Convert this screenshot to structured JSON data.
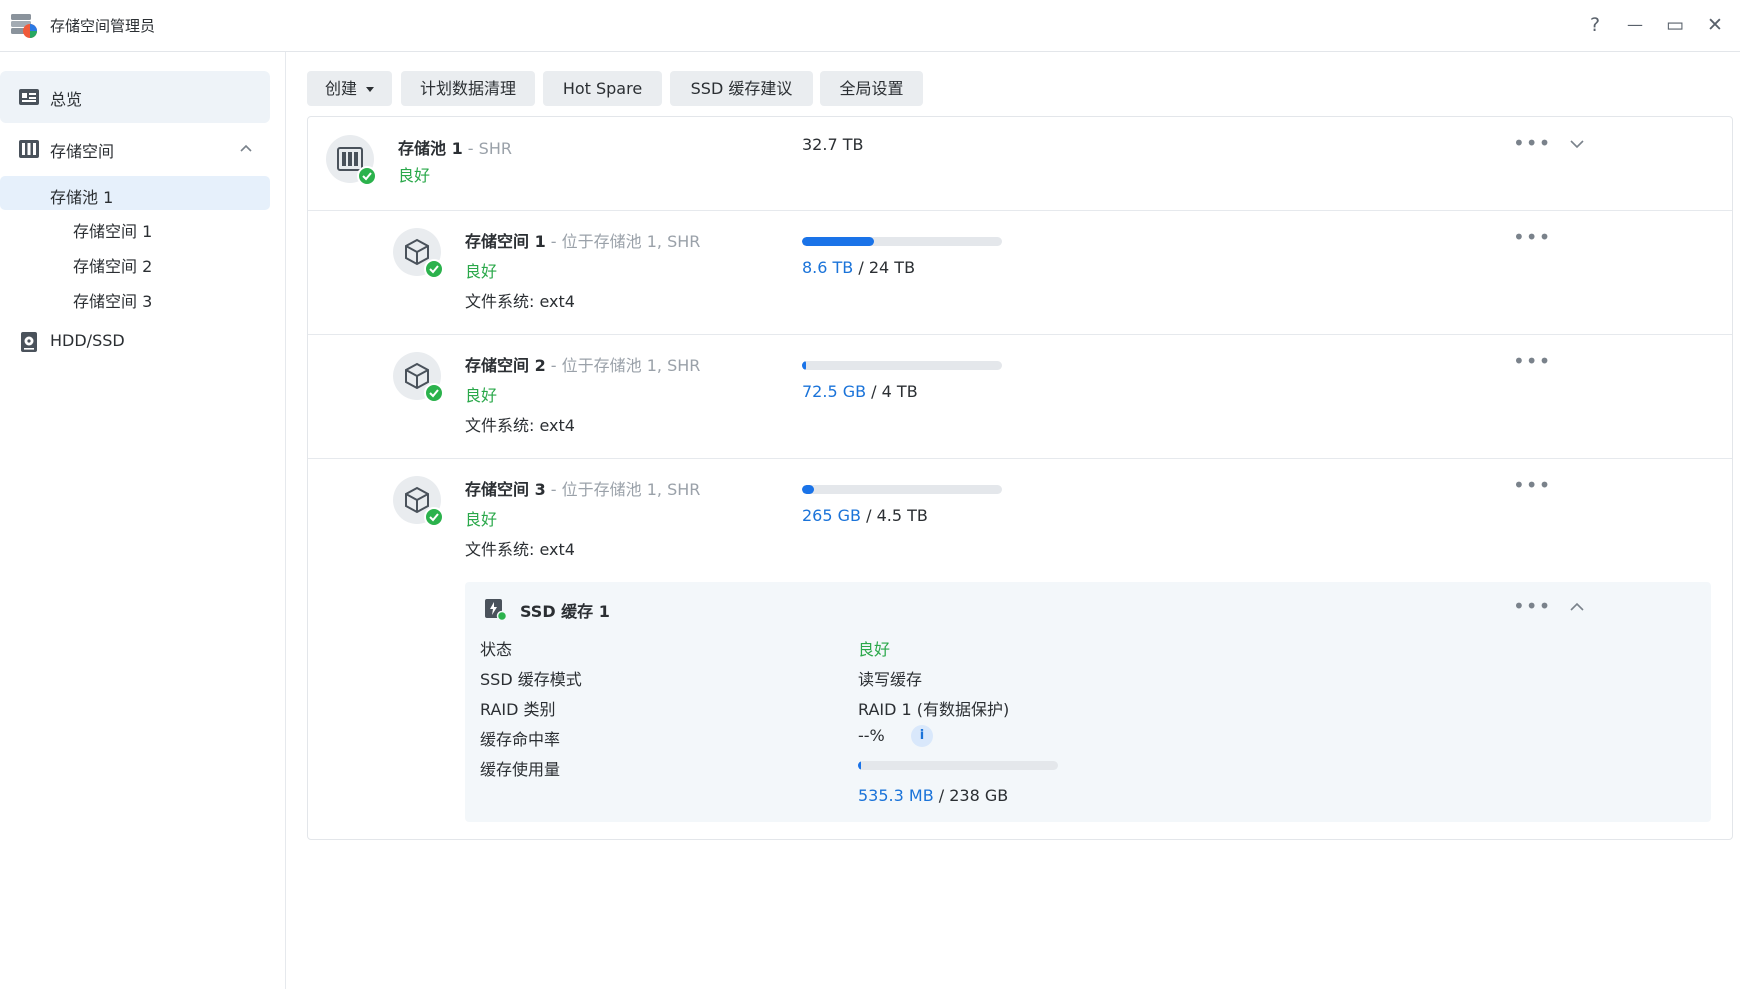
{
  "window": {
    "title": "存储空间管理员",
    "help": "?",
    "minimize": "—",
    "maximize": "▭",
    "close": "✕"
  },
  "sidebar": {
    "overview": "总览",
    "storage": "存储空间",
    "pool": "存储池 1",
    "volumes": [
      "存储空间 1",
      "存储空间 2",
      "存储空间 3"
    ],
    "hdd": "HDD/SSD"
  },
  "toolbar": {
    "create": "创建",
    "schedule_scrub": "计划数据清理",
    "hot_spare": "Hot Spare",
    "ssd_advisor": "SSD 缓存建议",
    "global_settings": "全局设置"
  },
  "pool": {
    "name": "存储池 1",
    "type": " - SHR",
    "status": "良好",
    "size": "32.7 TB"
  },
  "volumes": [
    {
      "name": "存储空间 1",
      "location": " - 位于存储池 1, SHR",
      "status": "良好",
      "fs": "文件系统: ext4",
      "used": "8.6 TB",
      "total": " / 24 TB",
      "fraction": 0.358
    },
    {
      "name": "存储空间 2",
      "location": " - 位于存储池 1, SHR",
      "status": "良好",
      "fs": "文件系统: ext4",
      "used": "72.5 GB",
      "total": " / 4 TB",
      "fraction": 0.018
    },
    {
      "name": "存储空间 3",
      "location": " - 位于存储池 1, SHR",
      "status": "良好",
      "fs": "文件系统: ext4",
      "used": "265 GB",
      "total": " / 4.5 TB",
      "fraction": 0.058
    }
  ],
  "cache": {
    "title": "SSD 缓存 1",
    "rows": [
      {
        "key": "状态",
        "value": "良好"
      },
      {
        "key": "SSD 缓存模式",
        "value": "读写缓存"
      },
      {
        "key": "RAID 类别",
        "value": "RAID 1 (有数据保护)"
      },
      {
        "key": "缓存命中率",
        "value": "--%"
      },
      {
        "key": "缓存使用量",
        "value": ""
      }
    ],
    "used": "535.3 MB",
    "total": " / 238 GB",
    "fraction": 0.002,
    "info": "i"
  },
  "colors": {
    "ok": "#2aa84a",
    "accent": "#1a73e8",
    "selected": "#e6f0fb"
  }
}
